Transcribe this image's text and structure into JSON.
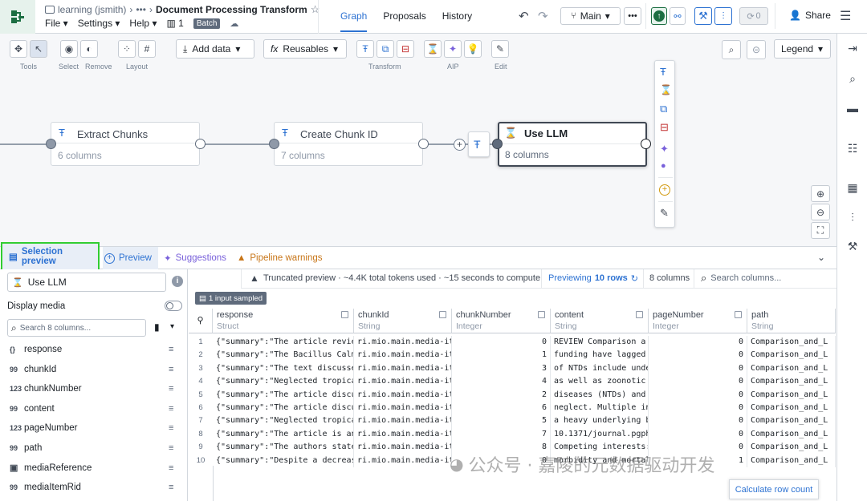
{
  "topbar": {
    "breadcrumb_user": "learning (jsmith)",
    "breadcrumb_more": "•••",
    "title": "Document Processing Transform",
    "menus": [
      "File",
      "Settings",
      "Help"
    ],
    "count": "1",
    "batch_label": "Batch",
    "tabs": [
      "Graph",
      "Proposals",
      "History"
    ],
    "branch": "Main",
    "sync_count": "0",
    "share_label": "Share"
  },
  "toolbar": {
    "groups": [
      "Tools",
      "Select",
      "Remove",
      "Layout",
      "Transform",
      "AIP",
      "Edit"
    ],
    "add_data": "Add data",
    "reusables": "Reusables",
    "legend": "Legend"
  },
  "nodes": [
    {
      "title": "Extract Chunks",
      "sub": "6 columns"
    },
    {
      "title": "Create Chunk ID",
      "sub": "7 columns"
    },
    {
      "title": "Use LLM",
      "sub": "8 columns"
    }
  ],
  "bottom_tabs": {
    "selection_preview": "Selection preview",
    "preview": "Preview",
    "suggestions": "Suggestions",
    "pipeline_warnings": "Pipeline warnings"
  },
  "left_panel": {
    "node_name": "Use LLM",
    "display_media": "Display media",
    "search_placeholder": "Search 8 columns...",
    "fields": [
      {
        "type": "{}",
        "name": "response"
      },
      {
        "type": "99",
        "name": "chunkId"
      },
      {
        "type": "123",
        "name": "chunkNumber"
      },
      {
        "type": "99",
        "name": "content"
      },
      {
        "type": "123",
        "name": "pageNumber"
      },
      {
        "type": "99",
        "name": "path"
      },
      {
        "type": "img",
        "name": "mediaReference"
      },
      {
        "type": "99",
        "name": "mediaItemRid"
      }
    ]
  },
  "preview_bar": {
    "truncated": "Truncated preview · ~4.4K total tokens used · ~15 seconds to compute",
    "previewing": "Previewing",
    "rows": "10 rows",
    "columns": "8 columns",
    "search_placeholder": "Search columns..."
  },
  "input_sampled": "1 input sampled",
  "table": {
    "columns": [
      {
        "name": "response",
        "type": "Struct"
      },
      {
        "name": "chunkId",
        "type": "String"
      },
      {
        "name": "chunkNumber",
        "type": "Integer"
      },
      {
        "name": "content",
        "type": "String"
      },
      {
        "name": "pageNumber",
        "type": "Integer"
      },
      {
        "name": "path",
        "type": "String"
      }
    ],
    "rows": [
      [
        "1",
        "{\"summary\":\"The article revie",
        "ri.mio.main.media-it",
        "0",
        "REVIEW  Comparison a",
        "0",
        "Comparison_and_L"
      ],
      [
        "2",
        "{\"summary\":\"The Bacillus Calm",
        "ri.mio.main.media-it",
        "1",
        "funding have lagged ",
        "0",
        "Comparison_and_L"
      ],
      [
        "3",
        "{\"summary\":\"The text discusse",
        "ri.mio.main.media-it",
        "3",
        "of NTDs include unde",
        "0",
        "Comparison_and_L"
      ],
      [
        "4",
        "{\"summary\":\"Neglected tropica",
        "ri.mio.main.media-it",
        "4",
        "as well as zoonotic ",
        "0",
        "Comparison_and_L"
      ],
      [
        "5",
        "{\"summary\":\"The article discu",
        "ri.mio.main.media-it",
        "2",
        "diseases (NTDs) and ",
        "0",
        "Comparison_and_L"
      ],
      [
        "6",
        "{\"summary\":\"The article discu",
        "ri.mio.main.media-it",
        "6",
        "neglect. Multiple in",
        "0",
        "Comparison_and_L"
      ],
      [
        "7",
        "{\"summary\":\"Neglected tropica",
        "ri.mio.main.media-it",
        "5",
        "a heavy underlying b",
        "0",
        "Comparison_and_L"
      ],
      [
        "8",
        "{\"summary\":\"The article is an",
        "ri.mio.main.media-it",
        "7",
        "10.1371/journal.pgph",
        "0",
        "Comparison_and_L"
      ],
      [
        "9",
        "{\"summary\":\"The authors state",
        "ri.mio.main.media-it",
        "8",
        "Competing interests:",
        "0",
        "Comparison_and_L"
      ],
      [
        "10",
        "{\"summary\":\"Despite a decreas",
        "ri.mio.main.media-it",
        "0",
        "morbidity and mortal",
        "1",
        "Comparison_and_L"
      ]
    ]
  },
  "calc_row_count": "Calculate row count",
  "watermark": "公众号 · 嘉陵的元数据驱动开发",
  "colors": {
    "accent": "#2d72d2",
    "highlight": "#32cd32",
    "warning": "#c87619",
    "aip": "#7961db",
    "green": "#1c6e42"
  }
}
